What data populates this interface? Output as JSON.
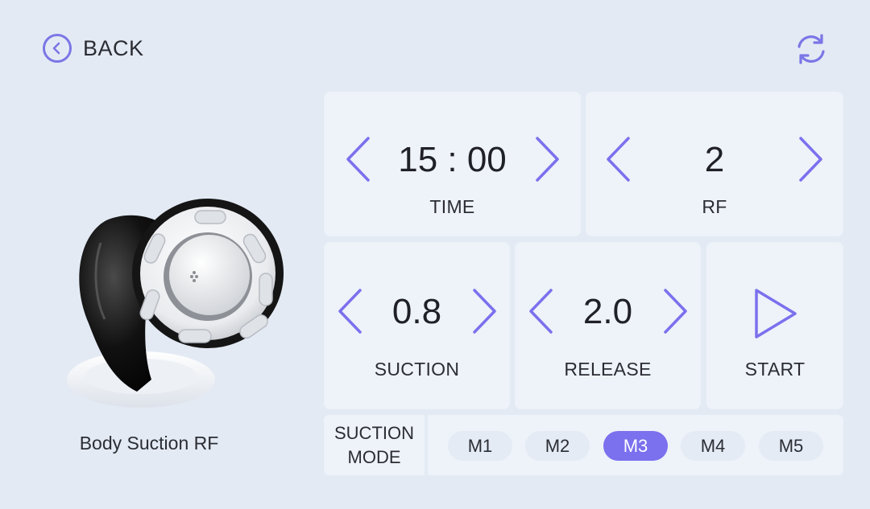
{
  "header": {
    "back_label": "BACK",
    "back_icon": "chevron-left-circle-icon",
    "refresh_icon": "refresh-icon"
  },
  "device": {
    "name": "Body Suction RF"
  },
  "controls": {
    "time": {
      "value": "15 : 00",
      "label": "TIME"
    },
    "rf": {
      "value": "2",
      "label": "RF"
    },
    "suction": {
      "value": "0.8",
      "label": "SUCTION"
    },
    "release": {
      "value": "2.0",
      "label": "RELEASE"
    },
    "start": {
      "label": "START",
      "icon": "play-icon"
    }
  },
  "suction_mode": {
    "label_line1": "SUCTION",
    "label_line2": "MODE",
    "modes": [
      "M1",
      "M2",
      "M3",
      "M4",
      "M5"
    ],
    "selected": "M3"
  },
  "colors": {
    "accent": "#7b70ee",
    "background": "#e3eaf4",
    "panel": "#eef2f9"
  }
}
